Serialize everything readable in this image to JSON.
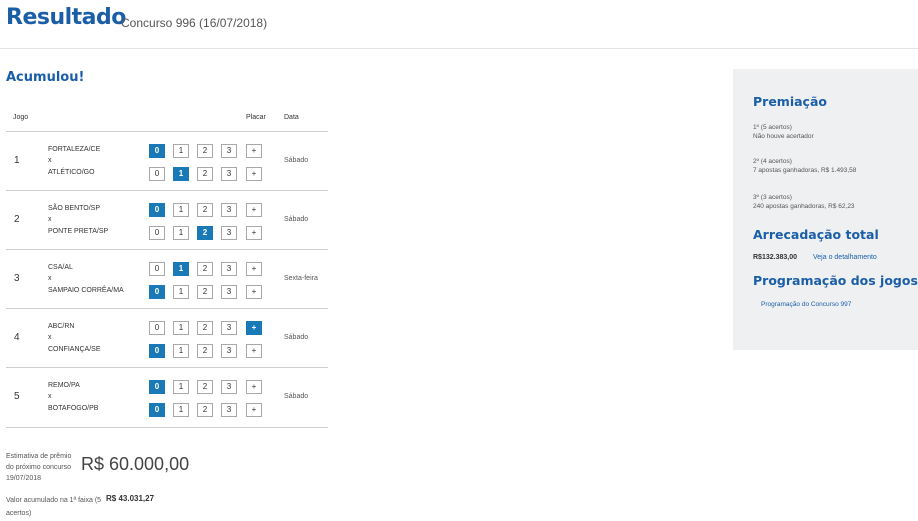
{
  "header": {
    "title": "Resultado",
    "subtitle": "Concurso 996 (16/07/2018)"
  },
  "status": "Acumulou!",
  "table": {
    "headers": {
      "jogo": "Jogo",
      "placar": "Placar",
      "data": "Data"
    },
    "vs": "x",
    "plus": "+",
    "scores": [
      "0",
      "1",
      "2",
      "3"
    ],
    "games": [
      {
        "num": "1",
        "home": "FORTALEZA/CE",
        "away": "ATLÉTICO/GO",
        "home_goals": "0",
        "away_goals": "1",
        "day": "Sábado"
      },
      {
        "num": "2",
        "home": "SÃO BENTO/SP",
        "away": "PONTE PRETA/SP",
        "home_goals": "0",
        "away_goals": "2",
        "day": "Sábado"
      },
      {
        "num": "3",
        "home": "CSA/AL",
        "away": "SAMPAIO CORRÊA/MA",
        "home_goals": "1",
        "away_goals": "0",
        "day": "Sexta-feira"
      },
      {
        "num": "4",
        "home": "ABC/RN",
        "away": "CONFIANÇA/SE",
        "home_goals": "+",
        "away_goals": "0",
        "day": "Sábado"
      },
      {
        "num": "5",
        "home": "REMO/PA",
        "away": "BOTAFOGO/PB",
        "home_goals": "0",
        "away_goals": "0",
        "day": "Sábado"
      }
    ]
  },
  "estimate": {
    "label": "Estimativa de prêmio do próximo concurso 19/07/2018",
    "value": "R$ 60.000,00"
  },
  "accumulated": {
    "label": "Valor acumulado na 1ª faixa (5 acertos)",
    "value": "R$ 43.031,27"
  },
  "sidebar": {
    "premiacao_title": "Premiação",
    "prizes": [
      {
        "tier": "1º (5 acertos)",
        "result": "Não houve acertador"
      },
      {
        "tier": "2º (4 acertos)",
        "result": "7 apostas ganhadoras, R$ 1.493,58"
      },
      {
        "tier": "3º (3 acertos)",
        "result": "240 apostas ganhadoras, R$ 62,23"
      }
    ],
    "arrecadacao_title": "Arrecadação total",
    "arrecadacao_value": "R$132.383,00",
    "arrecadacao_link": "Veja o detalhamento",
    "programacao_title": "Programação dos jogos",
    "programacao_link": "Programação do Concurso 997"
  },
  "colors": {
    "brand_blue": "#1b5ea8",
    "selected_box": "#1a7ab8",
    "sidebar_bg": "#eef0f2"
  }
}
